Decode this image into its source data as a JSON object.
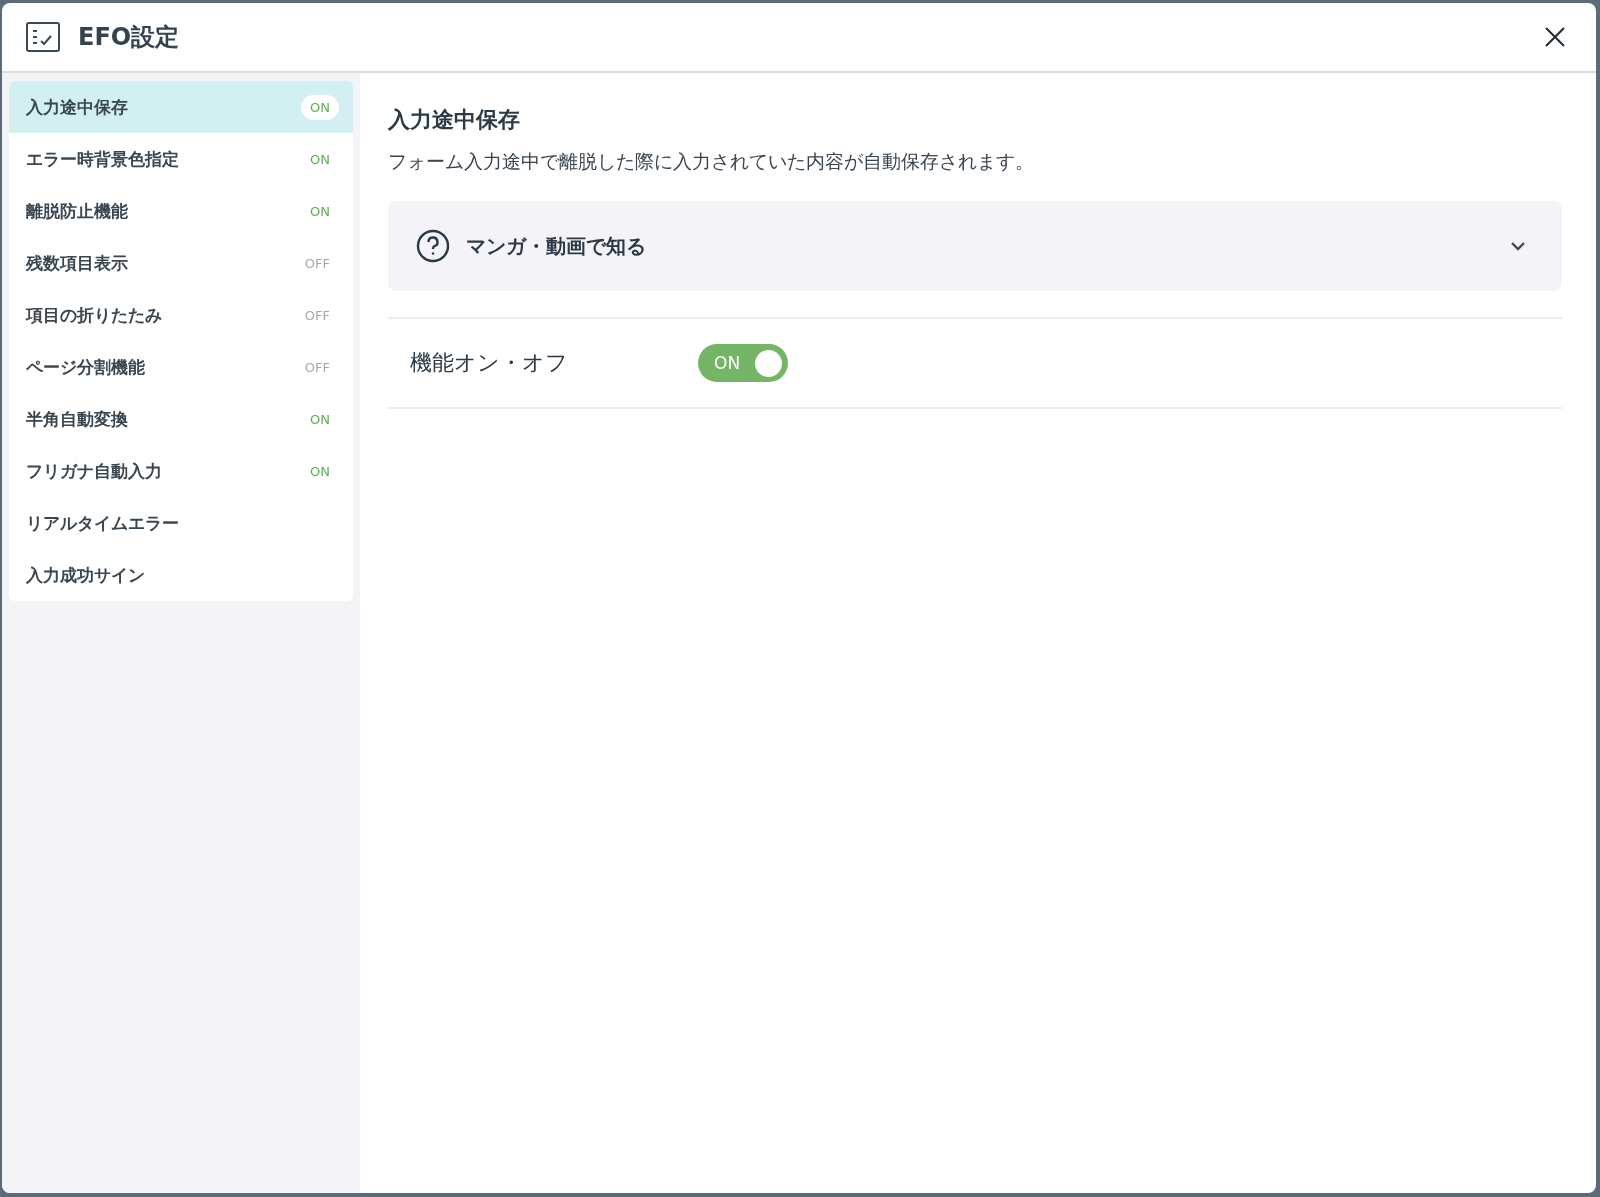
{
  "dialog": {
    "title": "EFO設定"
  },
  "sidebar": {
    "items": [
      {
        "label": "入力途中保存",
        "selected": true,
        "status": "ON",
        "on": true
      },
      {
        "label": "エラー時背景色指定",
        "selected": false,
        "status": "ON",
        "on": true
      },
      {
        "label": "離脱防止機能",
        "selected": false,
        "status": "ON",
        "on": true
      },
      {
        "label": "残数項目表示",
        "selected": false,
        "status": "OFF",
        "on": false
      },
      {
        "label": "項目の折りたたみ",
        "selected": false,
        "status": "OFF",
        "on": false
      },
      {
        "label": "ページ分割機能",
        "selected": false,
        "status": "OFF",
        "on": false
      },
      {
        "label": "半角自動変換",
        "selected": false,
        "status": "ON",
        "on": true
      },
      {
        "label": "フリガナ自動入力",
        "selected": false,
        "status": "ON",
        "on": true
      },
      {
        "label": "リアルタイムエラー",
        "selected": false
      },
      {
        "label": "入力成功サイン",
        "selected": false
      }
    ]
  },
  "content": {
    "heading": "入力途中保存",
    "description": "フォーム入力途中で離脱した際に入力されていた内容が自動保存されます。",
    "accordion": {
      "label": "マンガ・動画で知る",
      "expanded": false
    },
    "setting": {
      "label": "機能オン・オフ",
      "toggle_label": "ON",
      "on": true
    }
  }
}
